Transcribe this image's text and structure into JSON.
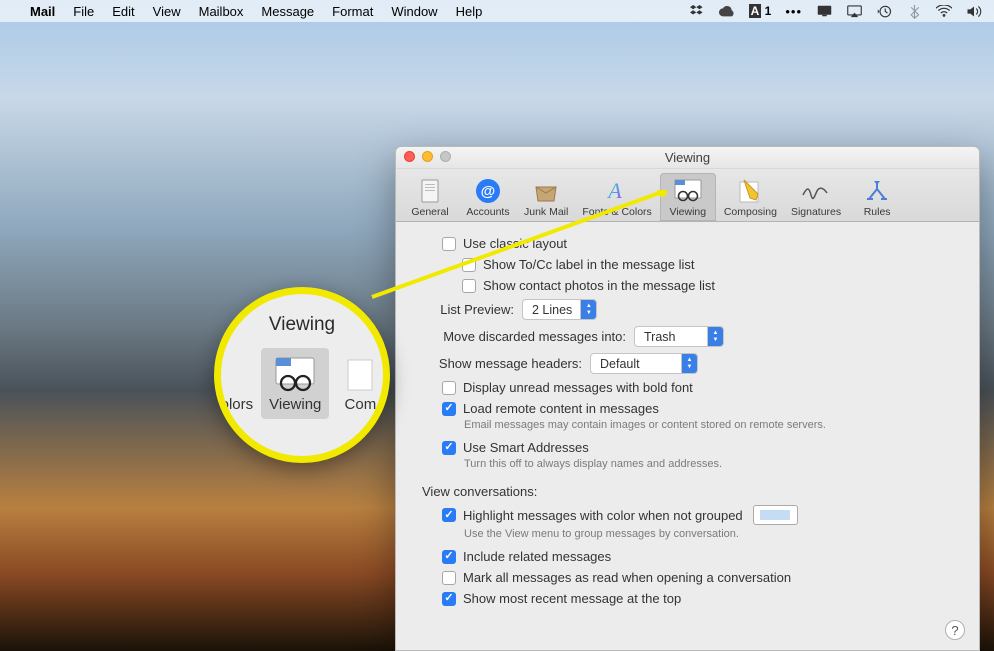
{
  "menubar": {
    "app": "Mail",
    "items": [
      "File",
      "Edit",
      "View",
      "Mailbox",
      "Message",
      "Format",
      "Window",
      "Help"
    ],
    "right_indicator": "1"
  },
  "window": {
    "title": "Viewing"
  },
  "toolbar": {
    "tabs": [
      {
        "label": "General"
      },
      {
        "label": "Accounts"
      },
      {
        "label": "Junk Mail"
      },
      {
        "label": "Fonts & Colors"
      },
      {
        "label": "Viewing"
      },
      {
        "label": "Composing"
      },
      {
        "label": "Signatures"
      },
      {
        "label": "Rules"
      }
    ]
  },
  "pane": {
    "use_classic_layout": {
      "label": "Use classic layout",
      "checked": false
    },
    "show_tocc": {
      "label": "Show To/Cc label in the message list",
      "checked": false
    },
    "show_contact_photos": {
      "label": "Show contact photos in the message list",
      "checked": false
    },
    "list_preview": {
      "label": "List Preview:",
      "value": "2 Lines"
    },
    "move_discarded": {
      "label": "Move discarded messages into:",
      "value": "Trash"
    },
    "show_headers": {
      "label": "Show message headers:",
      "value": "Default"
    },
    "display_unread_bold": {
      "label": "Display unread messages with bold font",
      "checked": false
    },
    "load_remote": {
      "label": "Load remote content in messages",
      "checked": true,
      "sub": "Email messages may contain images or content stored on remote servers."
    },
    "use_smart_addresses": {
      "label": "Use Smart Addresses",
      "checked": true,
      "sub": "Turn this off to always display names and addresses."
    },
    "conversations_header": "View conversations:",
    "highlight_color": {
      "label": "Highlight messages with color when not grouped",
      "checked": true,
      "sub": "Use the View menu to group messages by conversation."
    },
    "include_related": {
      "label": "Include related messages",
      "checked": true
    },
    "mark_all_read": {
      "label": "Mark all messages as read when opening a conversation",
      "checked": false
    },
    "show_most_recent": {
      "label": "Show most recent message at the top",
      "checked": true
    }
  },
  "callout": {
    "title": "Viewing",
    "left": "olors",
    "center": "Viewing",
    "right": "Com"
  }
}
